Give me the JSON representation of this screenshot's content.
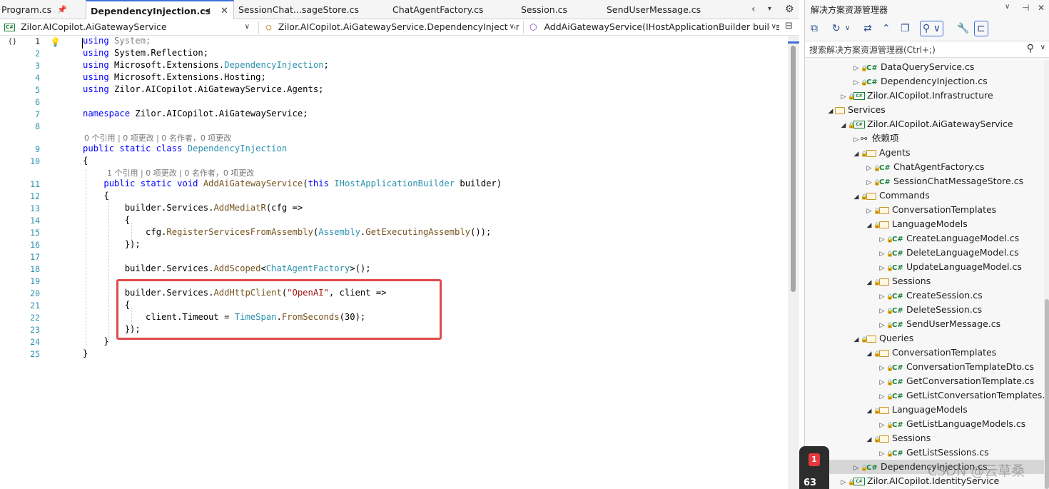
{
  "tabs": [
    {
      "label": "Program.cs",
      "active": false
    },
    {
      "label": "DependencyInjection.cs",
      "active": true
    },
    {
      "label": "SessionChat...sageStore.cs",
      "active": false
    },
    {
      "label": "ChatAgentFactory.cs",
      "active": false
    },
    {
      "label": "Session.cs",
      "active": false
    },
    {
      "label": "SendUserMessage.cs",
      "active": false
    }
  ],
  "navbar": {
    "project": "Zilor.AICopilot.AiGatewayService",
    "type": "Zilor.AICopilot.AiGatewayService.DependencyInjection",
    "member": "AddAiGatewayService(IHostApplicationBuilder builder)"
  },
  "code_lines": [
    "using System;",
    "using System.Reflection;",
    "using Microsoft.Extensions.DependencyInjection;",
    "using Microsoft.Extensions.Hosting;",
    "using Zilor.AICopilot.AiGatewayService.Agents;",
    "",
    "namespace Zilor.AICopilot.AiGatewayService;",
    "",
    "public static class DependencyInjection",
    "{",
    "    public static void AddAiGatewayService(this IHostApplicationBuilder builder)",
    "    {",
    "        builder.Services.AddMediatR(cfg =>",
    "        {",
    "            cfg.RegisterServicesFromAssembly(Assembly.GetExecutingAssembly());",
    "        });",
    "",
    "        builder.Services.AddScoped<ChatAgentFactory>();",
    "",
    "        builder.Services.AddHttpClient(\"OpenAI\", client =>",
    "        {",
    "            client.Timeout = TimeSpan.FromSeconds(30);",
    "        });",
    "    }",
    "}"
  ],
  "codelens": {
    "class_refs": "0 个引用 | 0 项更改 | 0 名作者，0 项更改",
    "method_refs": "1 个引用 | 0 项更改 | 0 名作者，0 项更改"
  },
  "solution_explorer": {
    "title": "解决方案资源管理器",
    "search_placeholder": "搜索解决方案资源管理器(Ctrl+;)",
    "tree": [
      {
        "label": "DataQueryService.cs",
        "kind": "cs",
        "depth": 3,
        "expand": "collapsed"
      },
      {
        "label": "DependencyInjection.cs",
        "kind": "cs",
        "depth": 3,
        "expand": "collapsed"
      },
      {
        "label": "Zilor.AICopilot.Infrastructure",
        "kind": "project",
        "depth": 2,
        "expand": "collapsed"
      },
      {
        "label": "Services",
        "kind": "folder",
        "depth": 1,
        "expand": "expanded"
      },
      {
        "label": "Zilor.AICopilot.AiGatewayService",
        "kind": "project",
        "depth": 2,
        "expand": "expanded"
      },
      {
        "label": "依赖项",
        "kind": "deps",
        "depth": 3,
        "expand": "collapsed"
      },
      {
        "label": "Agents",
        "kind": "folder",
        "depth": 3,
        "expand": "expanded"
      },
      {
        "label": "ChatAgentFactory.cs",
        "kind": "cs",
        "depth": 4,
        "expand": "collapsed"
      },
      {
        "label": "SessionChatMessageStore.cs",
        "kind": "cs",
        "depth": 4,
        "expand": "collapsed"
      },
      {
        "label": "Commands",
        "kind": "folder",
        "depth": 3,
        "expand": "expanded"
      },
      {
        "label": "ConversationTemplates",
        "kind": "folder",
        "depth": 4,
        "expand": "collapsed"
      },
      {
        "label": "LanguageModels",
        "kind": "folder",
        "depth": 4,
        "expand": "expanded"
      },
      {
        "label": "CreateLanguageModel.cs",
        "kind": "cs",
        "depth": 5,
        "expand": "collapsed"
      },
      {
        "label": "DeleteLanguageModel.cs",
        "kind": "cs",
        "depth": 5,
        "expand": "collapsed"
      },
      {
        "label": "UpdateLanguageModel.cs",
        "kind": "cs",
        "depth": 5,
        "expand": "collapsed"
      },
      {
        "label": "Sessions",
        "kind": "folder",
        "depth": 4,
        "expand": "expanded"
      },
      {
        "label": "CreateSession.cs",
        "kind": "cs",
        "depth": 5,
        "expand": "collapsed"
      },
      {
        "label": "DeleteSession.cs",
        "kind": "cs",
        "depth": 5,
        "expand": "collapsed"
      },
      {
        "label": "SendUserMessage.cs",
        "kind": "cs",
        "depth": 5,
        "expand": "collapsed"
      },
      {
        "label": "Queries",
        "kind": "folder",
        "depth": 3,
        "expand": "expanded"
      },
      {
        "label": "ConversationTemplates",
        "kind": "folder",
        "depth": 4,
        "expand": "expanded"
      },
      {
        "label": "ConversationTemplateDto.cs",
        "kind": "cs",
        "depth": 5,
        "expand": "collapsed"
      },
      {
        "label": "GetConversationTemplate.cs",
        "kind": "cs",
        "depth": 5,
        "expand": "collapsed"
      },
      {
        "label": "GetListConversationTemplates.cs",
        "kind": "cs",
        "depth": 5,
        "expand": "collapsed"
      },
      {
        "label": "LanguageModels",
        "kind": "folder",
        "depth": 4,
        "expand": "expanded"
      },
      {
        "label": "GetListLanguageModels.cs",
        "kind": "cs",
        "depth": 5,
        "expand": "collapsed"
      },
      {
        "label": "Sessions",
        "kind": "folder",
        "depth": 4,
        "expand": "expanded"
      },
      {
        "label": "GetListSessions.cs",
        "kind": "cs",
        "depth": 5,
        "expand": "collapsed"
      },
      {
        "label": "DependencyInjection.cs",
        "kind": "cs",
        "depth": 3,
        "expand": "collapsed",
        "selected": true
      },
      {
        "label": "Zilor.AICopilot.IdentityService",
        "kind": "project",
        "depth": 2,
        "expand": "collapsed"
      }
    ]
  },
  "watermark": "CSDN @云草桑",
  "notification": {
    "count": "1",
    "percent": "63"
  },
  "colors": {
    "highlight_border": "#e04a4a",
    "keyword": "#0000ff",
    "type": "#2b91af",
    "string": "#a31515"
  }
}
